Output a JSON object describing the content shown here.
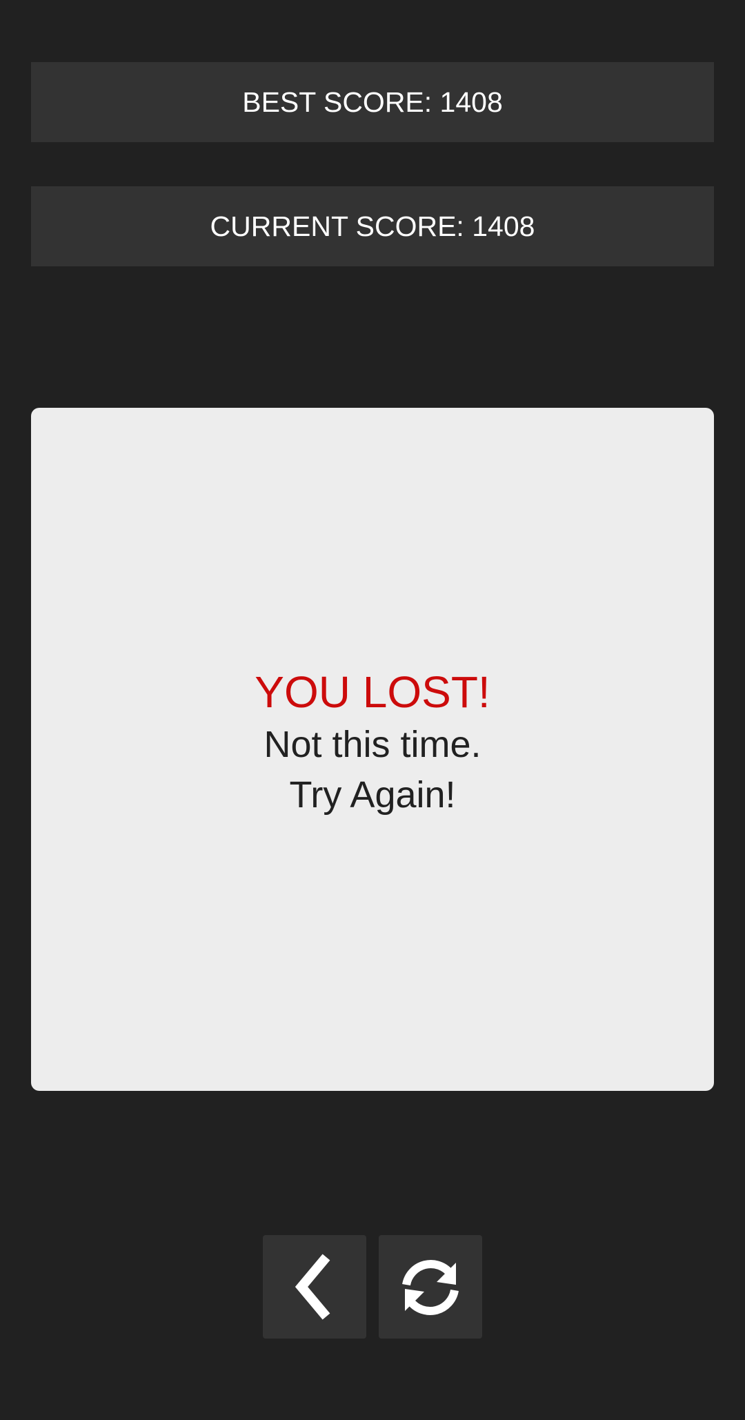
{
  "scores": {
    "best_label": "BEST SCORE: 1408",
    "current_label": "CURRENT SCORE: 1408"
  },
  "result": {
    "title": "YOU LOST!",
    "line1": "Not this time.",
    "line2": "Try Again!",
    "title_color": "#cc0b0b"
  },
  "controls": {
    "back_icon": "chevron-left-icon",
    "restart_icon": "refresh-icon"
  },
  "colors": {
    "background": "#212121",
    "panel": "#333333",
    "board": "#ededed"
  }
}
